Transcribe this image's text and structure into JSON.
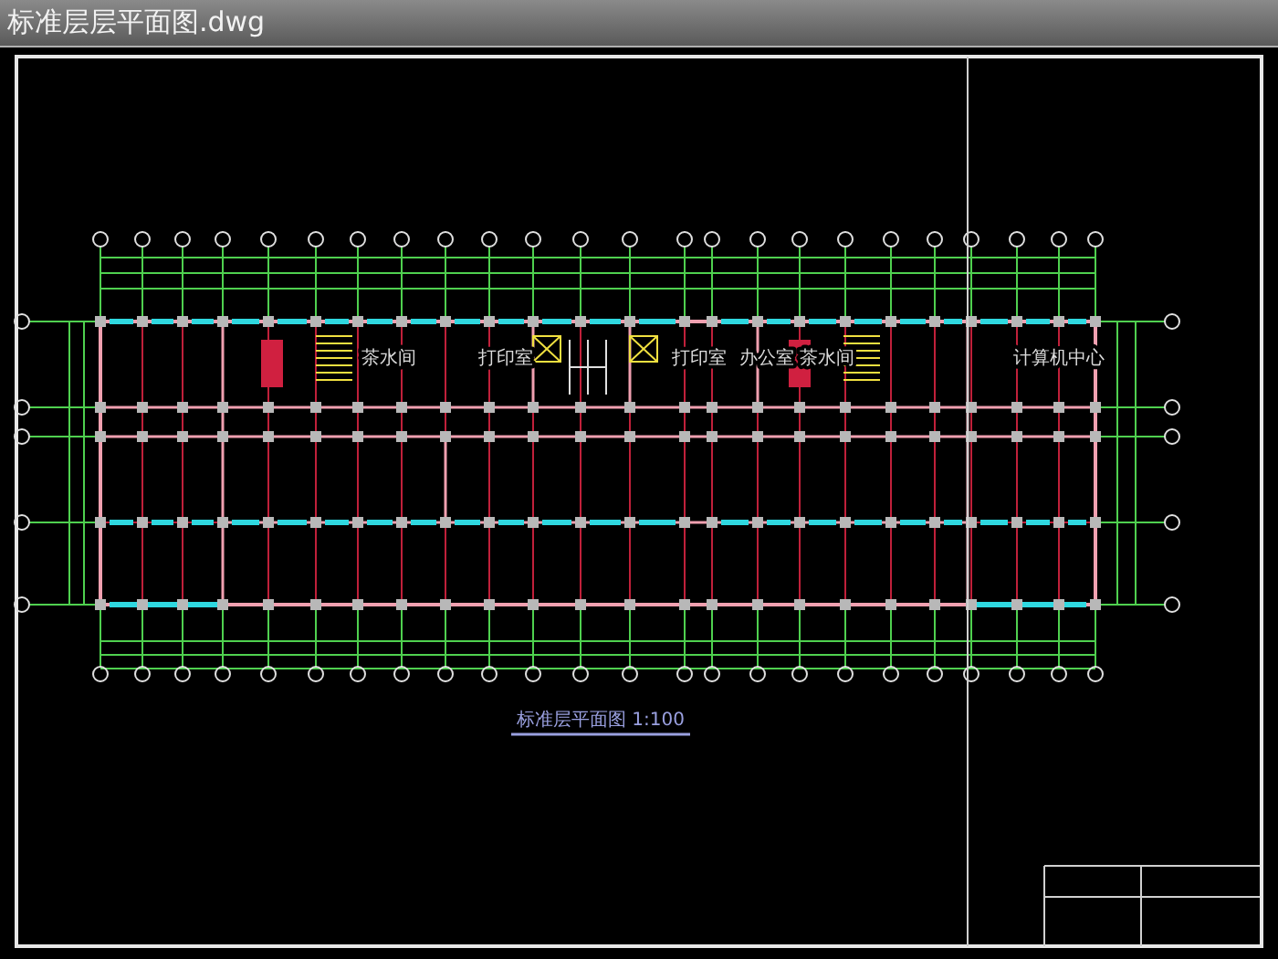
{
  "window": {
    "title": "标准层层平面图.dwg"
  },
  "drawing": {
    "rooms": [
      {
        "label": "茶水间"
      },
      {
        "label": "打印室"
      },
      {
        "label": "打印室"
      },
      {
        "label": "办公室"
      },
      {
        "label": "茶水间"
      },
      {
        "label": "计算机中心"
      }
    ],
    "plan_title": "标准层平面图 1:100"
  }
}
